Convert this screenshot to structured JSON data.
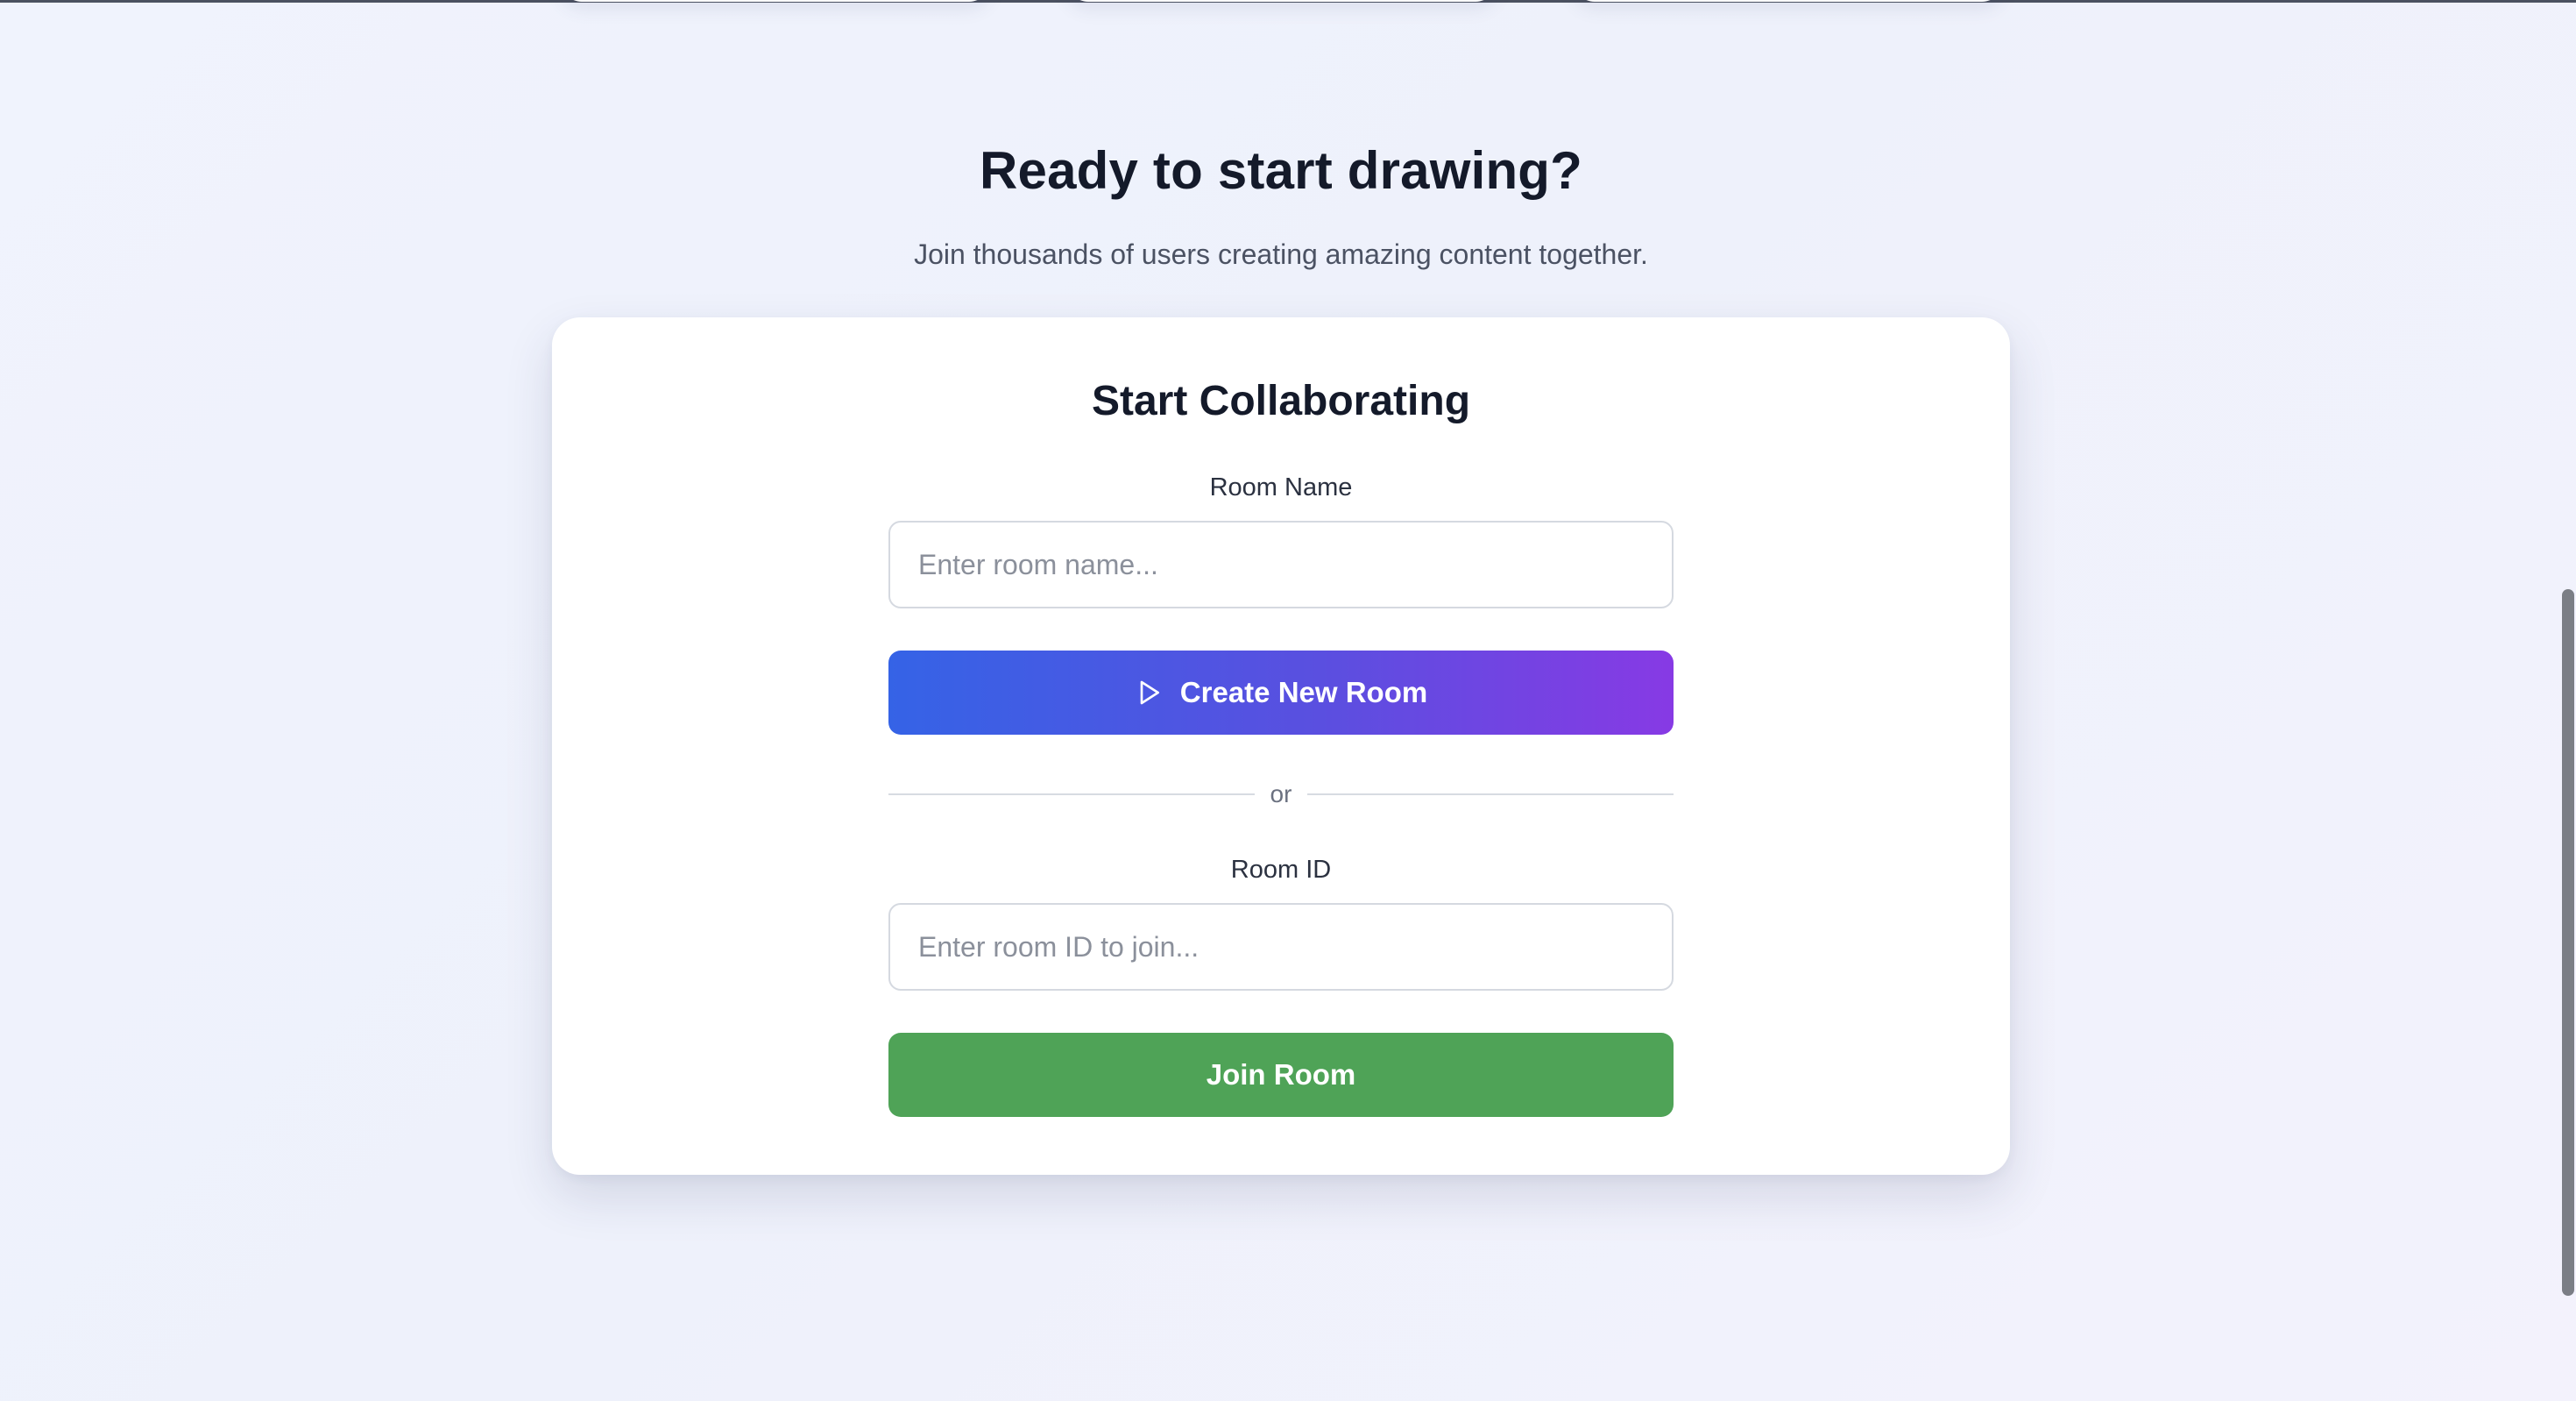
{
  "cta": {
    "title": "Ready to start drawing?",
    "subtitle": "Join thousands of users creating amazing content together."
  },
  "card": {
    "title": "Start Collaborating",
    "room_name": {
      "label": "Room Name",
      "placeholder": "Enter room name...",
      "value": ""
    },
    "create_button": {
      "label": "Create New Room",
      "icon": "play-icon"
    },
    "divider_text": "or",
    "room_id": {
      "label": "Room ID",
      "placeholder": "Enter room ID to join...",
      "value": ""
    },
    "join_button": {
      "label": "Join Room"
    }
  },
  "colors": {
    "gradient_start": "#3563e6",
    "gradient_end": "#873ae4",
    "join_green": "#4fa357",
    "heading": "#141a2a"
  }
}
